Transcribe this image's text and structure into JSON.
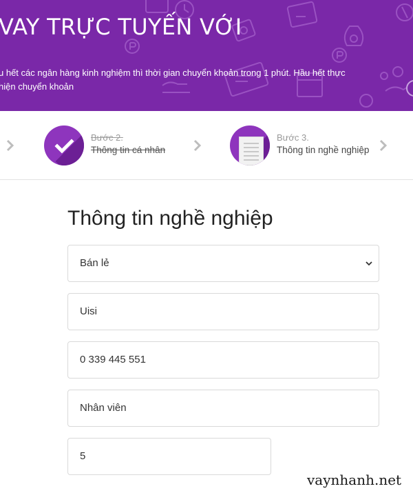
{
  "banner": {
    "title": "VAY TRỰC TUYẾN VỚI",
    "text": "u hết các ngân hàng kinh nghiệm thì thời gian chuyển khoản trong 1 phút. Hầu hết thực hiện chuyển khoản",
    "background": "#7a28a8"
  },
  "steps": [
    {
      "small": "Bước 2.",
      "label": "Thông tin cá nhân",
      "status": "done",
      "icon": "check-icon"
    },
    {
      "small": "Bước 3.",
      "label": "Thông tin nghề nghiệp",
      "status": "current",
      "icon": "document-icon"
    }
  ],
  "form": {
    "title": "Thông tin nghề nghiệp",
    "industry_select": "Bán lẻ",
    "company_field": "Uisi",
    "phone_field": "0 339 445 551",
    "position_field": "Nhân viên",
    "years_field": "5"
  },
  "watermark": "vaynhanh.net",
  "colors": {
    "accent": "#8e35bd",
    "banner": "#7a28a8"
  }
}
